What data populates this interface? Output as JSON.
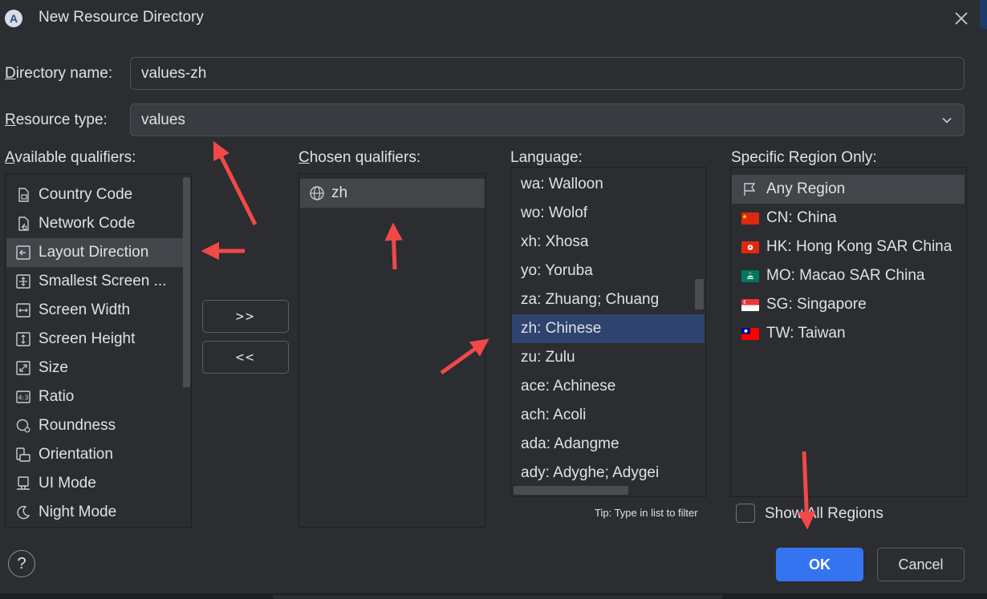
{
  "window": {
    "title": "New Resource Directory",
    "app_icon_letter": "A"
  },
  "form": {
    "directory_name_label_first": "D",
    "directory_name_label_rest": "irectory name:",
    "directory_name_value": "values-zh",
    "resource_type_label_first": "R",
    "resource_type_label_rest": "esource type:",
    "resource_type_value": "values"
  },
  "available": {
    "label_first": "A",
    "label_rest": "vailable qualifiers:",
    "items": [
      {
        "label": "Country Code",
        "icon": "sim-card-icon"
      },
      {
        "label": "Network Code",
        "icon": "network-icon"
      },
      {
        "label": "Layout Direction",
        "icon": "layout-direction-icon",
        "selected": true
      },
      {
        "label": "Smallest Screen ...",
        "icon": "smallest-screen-icon"
      },
      {
        "label": "Screen Width",
        "icon": "screen-width-icon"
      },
      {
        "label": "Screen Height",
        "icon": "screen-height-icon"
      },
      {
        "label": "Size",
        "icon": "size-icon"
      },
      {
        "label": "Ratio",
        "icon": "ratio-icon"
      },
      {
        "label": "Roundness",
        "icon": "roundness-icon"
      },
      {
        "label": "Orientation",
        "icon": "orientation-icon"
      },
      {
        "label": "UI Mode",
        "icon": "ui-mode-icon"
      },
      {
        "label": "Night Mode",
        "icon": "night-mode-icon"
      }
    ]
  },
  "move_buttons": {
    "add": ">>",
    "remove": "<<"
  },
  "chosen": {
    "label_first": "C",
    "label_rest": "hosen qualifiers:",
    "items": [
      {
        "label": "zh",
        "icon": "globe-icon"
      }
    ]
  },
  "language": {
    "label": "Language:",
    "items": [
      {
        "label": "wa: Walloon"
      },
      {
        "label": "wo: Wolof"
      },
      {
        "label": "xh: Xhosa"
      },
      {
        "label": "yo: Yoruba"
      },
      {
        "label": "za: Zhuang; Chuang"
      },
      {
        "label": "zh: Chinese",
        "selected": true
      },
      {
        "label": "zu: Zulu"
      },
      {
        "label": "ace: Achinese"
      },
      {
        "label": "ach: Acoli"
      },
      {
        "label": "ada: Adangme"
      },
      {
        "label": "ady: Adyghe; Adygei"
      }
    ],
    "tip": "Tip: Type in list to filter"
  },
  "region": {
    "label": "Specific Region Only:",
    "items": [
      {
        "label": "Any Region",
        "icon": "flag-outline-icon",
        "selected": true
      },
      {
        "label": "CN: China",
        "icon": "china-flag-icon"
      },
      {
        "label": "HK: Hong Kong SAR China",
        "icon": "hong-kong-flag-icon"
      },
      {
        "label": "MO: Macao SAR China",
        "icon": "macao-flag-icon"
      },
      {
        "label": "SG: Singapore",
        "icon": "singapore-flag-icon"
      },
      {
        "label": "TW: Taiwan",
        "icon": "taiwan-flag-icon"
      }
    ],
    "show_all_label": "Show All Regions",
    "show_all_checked": false
  },
  "footer": {
    "help": "?",
    "ok": "OK",
    "cancel": "Cancel"
  },
  "colors": {
    "background": "#2b2d30",
    "accent": "#3574f0",
    "selection": "#2e436e",
    "annotation_arrow": "#f24848"
  }
}
